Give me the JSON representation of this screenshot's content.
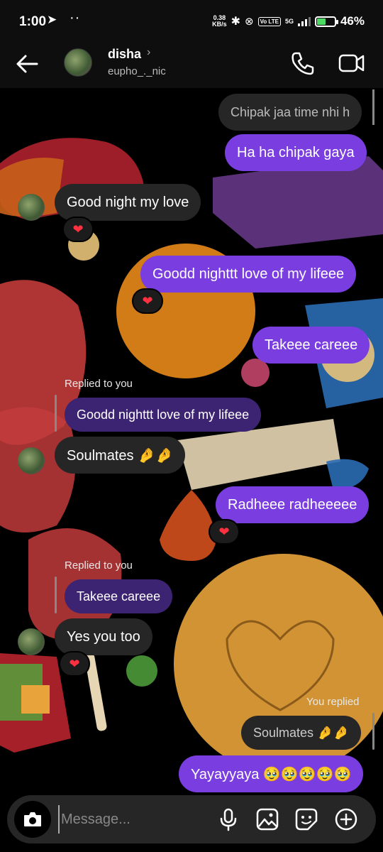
{
  "status_bar": {
    "time": "1:00",
    "speed_value": "0.38",
    "speed_unit": "KB/s",
    "volte": "Vo LTE",
    "network": "5G",
    "battery_pct": "46%",
    "battery_level": 0.46
  },
  "header": {
    "name": "disha",
    "chevron": "›",
    "username": "eupho_._nic"
  },
  "messages": {
    "m1": "Chipak jaa time nhi h",
    "m2": "Ha ha chipak gaya",
    "m3": "Good night my love",
    "m4": "Goodd nighttt love of my lifeee",
    "m5": "Takeee careee",
    "reply1_label": "Replied to you",
    "reply1_quote": "Goodd nighttt love of my lifeee",
    "m6": "Soulmates 🤌🤌",
    "m7": "Radheee radheeeee",
    "reply2_label": "Replied to you",
    "reply2_quote": "Takeee careee",
    "m8": "Yes you too",
    "reply3_label": "You replied",
    "reply3_quote": "Soulmates 🤌🤌",
    "m9": "Yayayyaya 🥹🥹🥹🥹🥹",
    "reaction": "❤"
  },
  "composer": {
    "placeholder": "Message..."
  },
  "colors": {
    "outgoing_bubble": "#7a3ee0",
    "incoming_bubble": "#262626",
    "heart": "#ff3040"
  }
}
